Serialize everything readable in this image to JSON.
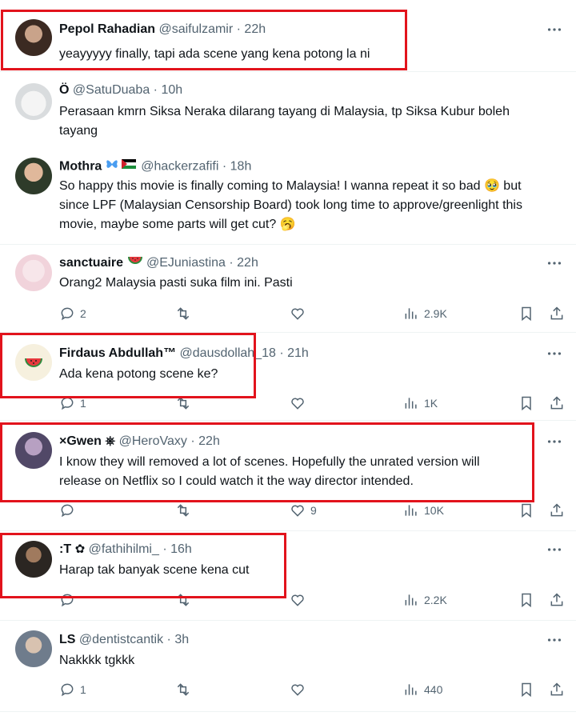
{
  "tweets": [
    {
      "name": "Pepol Rahadian",
      "handle": "@saifulzamir",
      "sep": "·",
      "time": "22h",
      "badge": "",
      "lines": [
        "yeayyyyy finally, tapi ada scene yang kena potong la ni"
      ],
      "actions": null
    },
    {
      "name": "Ö",
      "handle": "@SatuDuaba",
      "sep": "·",
      "time": "10h",
      "badge": "",
      "lines": [
        "Perasaan kmrn Siksa Neraka dilarang tayang di Malaysia, tp Siksa Kubur boleh",
        "tayang"
      ],
      "actions": null
    },
    {
      "name": "Mothra",
      "handle": "@hackerzafifi",
      "sep": "·",
      "time": "18h",
      "badge": "",
      "lines": [
        "So happy this movie is finally coming to Malaysia! I wanna repeat it so bad 🥹 but",
        "since LPF (Malaysian Censorship Board) took long time to approve/greenlight this",
        "movie, maybe some parts will get cut? 🥱"
      ],
      "actions": null
    },
    {
      "name": "sanctuaire",
      "handle": "@EJuniastina",
      "sep": "·",
      "time": "22h",
      "badge": "",
      "lines": [
        "Orang2 Malaysia pasti suka film ini. Pasti"
      ],
      "actions": {
        "replies": "2",
        "reposts": "",
        "likes": "",
        "views": "2.9K"
      }
    },
    {
      "name": "Firdaus Abdullah™",
      "handle": "@dausdollah_18",
      "sep": "·",
      "time": "21h",
      "badge": "",
      "lines": [
        "Ada kena potong scene ke?"
      ],
      "actions": {
        "replies": "1",
        "reposts": "",
        "likes": "",
        "views": "1K"
      }
    },
    {
      "name": "×Gwen ⎈",
      "handle": "@HeroVaxy",
      "sep": "·",
      "time": "22h",
      "badge": "",
      "lines": [
        "I know they will removed a lot of scenes. Hopefully the unrated version will",
        "release on Netflix so I could watch it the way director intended."
      ],
      "actions": {
        "replies": "",
        "reposts": "",
        "likes": "9",
        "views": "10K"
      }
    },
    {
      "name": ":T",
      "handle": "@fathihilmi_",
      "sep": "·",
      "time": "16h",
      "badge": "✿",
      "lines": [
        "Harap tak banyak scene kena cut"
      ],
      "actions": {
        "replies": "",
        "reposts": "",
        "likes": "",
        "views": "2.2K"
      }
    },
    {
      "name": "LS",
      "handle": "@dentistcantik",
      "sep": "·",
      "time": "3h",
      "badge": "",
      "lines": [
        "Nakkkk tgkkk"
      ],
      "actions": {
        "replies": "1",
        "reposts": "",
        "likes": "",
        "views": "440"
      }
    }
  ],
  "icons": {
    "more": "more-dots-icon",
    "reply": "reply-icon",
    "repost": "repost-icon",
    "like": "like-icon",
    "views": "views-icon",
    "bookmark": "bookmark-icon",
    "share": "share-icon"
  },
  "colors": {
    "name": "#0f1419",
    "meta": "#536471",
    "divider": "#eff3f4",
    "highlight": "#e2131c"
  }
}
